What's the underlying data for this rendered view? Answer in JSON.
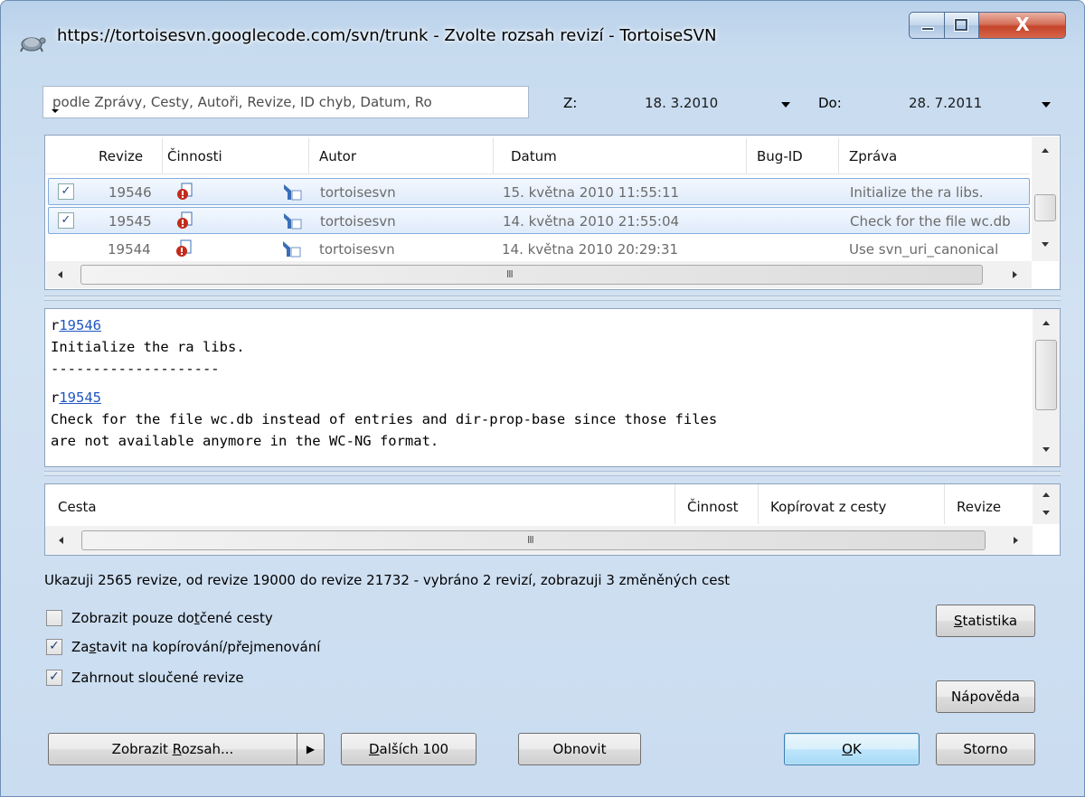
{
  "window": {
    "title": "https://tortoisesvn.googlecode.com/svn/trunk - Zvolte rozsah revizí - TortoiseSVN",
    "close_glyph": "X"
  },
  "filter": {
    "placeholder": "podle Zprávy, Cesty, Autoři, Revize, ID chyb, Datum, Ro",
    "from_label": "Z:",
    "from_date": "18.  3.2010",
    "to_label": "Do:",
    "to_date": "28.  7.2011"
  },
  "log_table": {
    "columns": [
      "Revize",
      "Činnosti",
      "Autor",
      "Datum",
      "Bug-ID",
      "Zpráva"
    ],
    "rows": [
      {
        "checked": true,
        "revision": "19546",
        "author": "tortoisesvn",
        "date": "15. května 2010 11:55:11",
        "bug_id": "",
        "message": "Initialize the ra libs."
      },
      {
        "checked": true,
        "revision": "19545",
        "author": "tortoisesvn",
        "date": "14. května 2010 21:55:04",
        "bug_id": "",
        "message": "Check for the file wc.db"
      },
      {
        "checked": false,
        "revision": "19544",
        "author": "tortoisesvn",
        "date": "14. května 2010 20:29:31",
        "bug_id": "",
        "message": "Use svn_uri_canonical"
      }
    ],
    "hscroll_grip": "III"
  },
  "message_panel": {
    "entries": [
      {
        "prefix": "r",
        "revision": "19546",
        "text": "Initialize the ra libs."
      },
      {
        "separator": "--------------------"
      },
      {
        "prefix": "r",
        "revision": "19545",
        "line1": "Check for the file wc.db instead of entries and dir-prop-base since those files",
        "line2": "are not available anymore in the WC-NG format."
      }
    ]
  },
  "path_table": {
    "columns": [
      "Cesta",
      "Činnost",
      "Kopírovat z cesty",
      "Revize"
    ],
    "hscroll_grip": "III"
  },
  "status_text": "Ukazuji 2565 revize, od revize 19000 do revize 21732 - vybráno 2 revizí, zobrazuji 3 změněných cest",
  "options": [
    {
      "label_pre": "Zobrazit pouze do",
      "label_u": "t",
      "label_post": "čené cesty",
      "checked": false
    },
    {
      "label_pre": "Za",
      "label_u": "s",
      "label_post": "tavit na kopírování/přejmenování",
      "checked": true
    },
    {
      "label_pre": "Zahrnout sloučené revize",
      "label_u": "",
      "label_post": "",
      "checked": true
    }
  ],
  "check_glyph": "✓",
  "buttons": {
    "stats_pre": "",
    "stats_u": "S",
    "stats_post": "tatistika",
    "help": "Nápověda",
    "show_range_pre": "Zobrazit ",
    "show_range_u": "R",
    "show_range_post": "ozsah...",
    "show_range_arrow": "▶",
    "next_pre": "",
    "next_u": "D",
    "next_post": "alších 100",
    "refresh": "Obnovit",
    "ok_pre": "",
    "ok_u": "O",
    "ok_post": "K",
    "cancel": "Storno"
  },
  "icons": {
    "app": "tortoisesvn-icon",
    "action": "modified-file-icon",
    "author": "svn-author-icon"
  },
  "colors": {
    "selection_border": "#84acdd",
    "link": "#1f56c4",
    "close_button": "#c4442a"
  }
}
